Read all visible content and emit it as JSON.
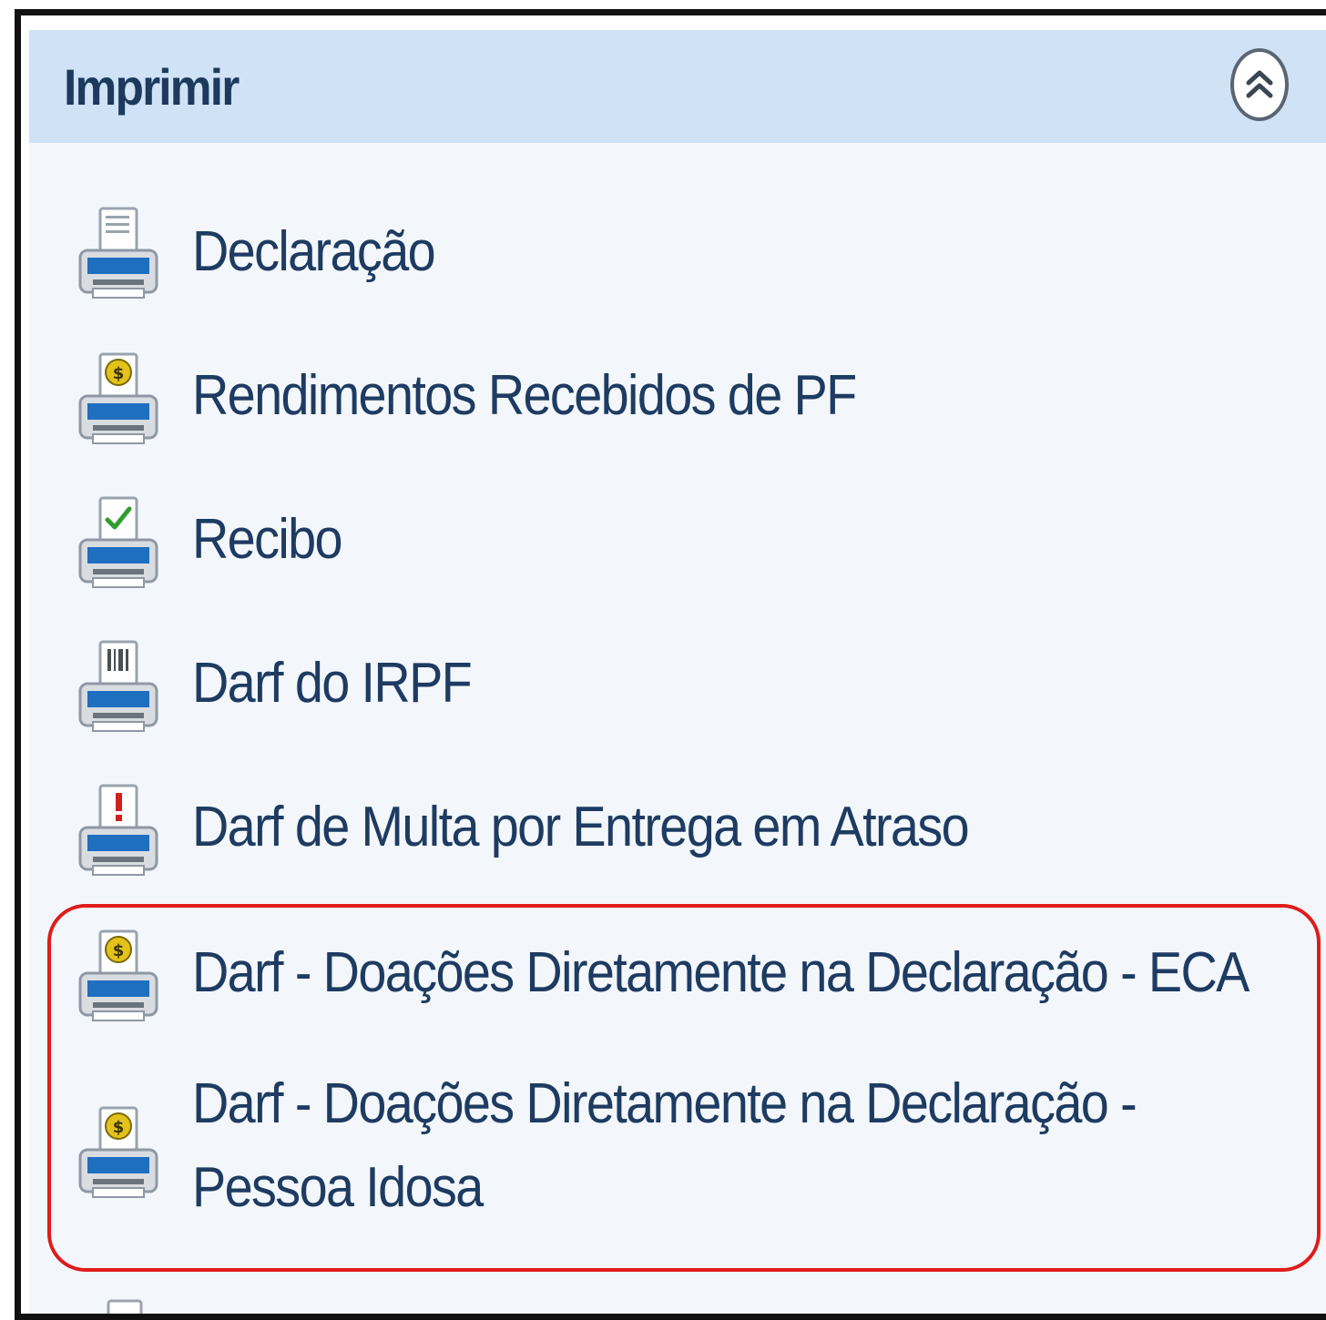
{
  "panel": {
    "title": "Imprimir",
    "collapse_icon": "double-chevron-up-icon"
  },
  "items": [
    {
      "label": "Declaração",
      "icon": "printer-doc-icon"
    },
    {
      "label": "Rendimentos Recebidos de PF",
      "icon": "printer-coin-icon"
    },
    {
      "label": "Recibo",
      "icon": "printer-check-icon"
    },
    {
      "label": "Darf do IRPF",
      "icon": "printer-barcode-icon"
    },
    {
      "label": "Darf de Multa por Entrega em Atraso",
      "icon": "printer-alert-icon"
    },
    {
      "label": "Darf - Doações Diretamente na Declaração - ECA",
      "icon": "printer-coin-icon"
    },
    {
      "label": "Darf - Doações Diretamente na Declaração - Pessoa Idosa",
      "icon": "printer-coin-icon"
    }
  ],
  "colors": {
    "header_bg": "#cfe2f6",
    "panel_bg": "#f3f7fb",
    "text": "#1e3b62",
    "highlight_border": "#e01b1b",
    "printer_blue": "#1f6fc1"
  }
}
